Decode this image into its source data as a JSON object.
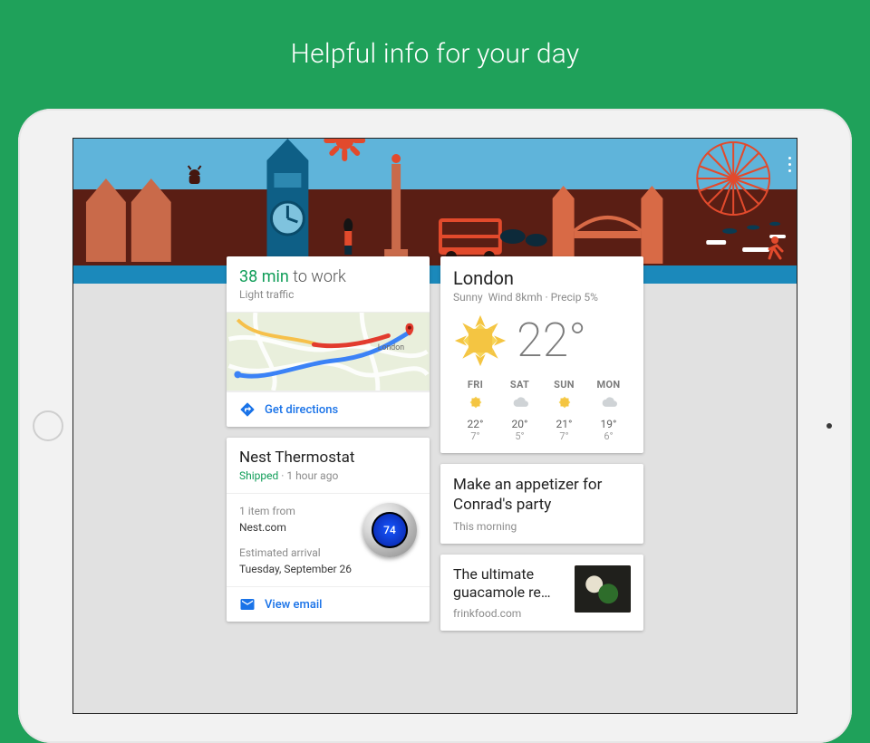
{
  "hero": {
    "title": "Helpful info for your day"
  },
  "commute": {
    "time": "38 min",
    "dest_suffix": " to work",
    "subtitle": "Light traffic",
    "map_label": "London",
    "action": "Get directions"
  },
  "package": {
    "title": "Nest Thermostat",
    "status": "Shipped",
    "status_time": " · 1 hour ago",
    "items_line": "1 item from",
    "merchant": "Nest.com",
    "eta_label": "Estimated arrival",
    "eta_value": "Tuesday, September 26",
    "thermo_value": "74",
    "action": "View email"
  },
  "weather": {
    "city": "London",
    "condition": "Sunny",
    "details": "Wind 8kmh · Precip 5%",
    "temp": "22°",
    "forecast": [
      {
        "day": "FRI",
        "icon": "sun",
        "hi": "22°",
        "lo": "7°"
      },
      {
        "day": "SAT",
        "icon": "cloud",
        "hi": "20°",
        "lo": "5°"
      },
      {
        "day": "SUN",
        "icon": "sun",
        "hi": "21°",
        "lo": "7°"
      },
      {
        "day": "MON",
        "icon": "cloud",
        "hi": "19°",
        "lo": "6°"
      }
    ]
  },
  "reminder": {
    "title": "Make an appetizer for Conrad's party",
    "when": "This morning"
  },
  "article": {
    "title": "The ultimate guacamole re…",
    "source": "frinkfood.com"
  }
}
